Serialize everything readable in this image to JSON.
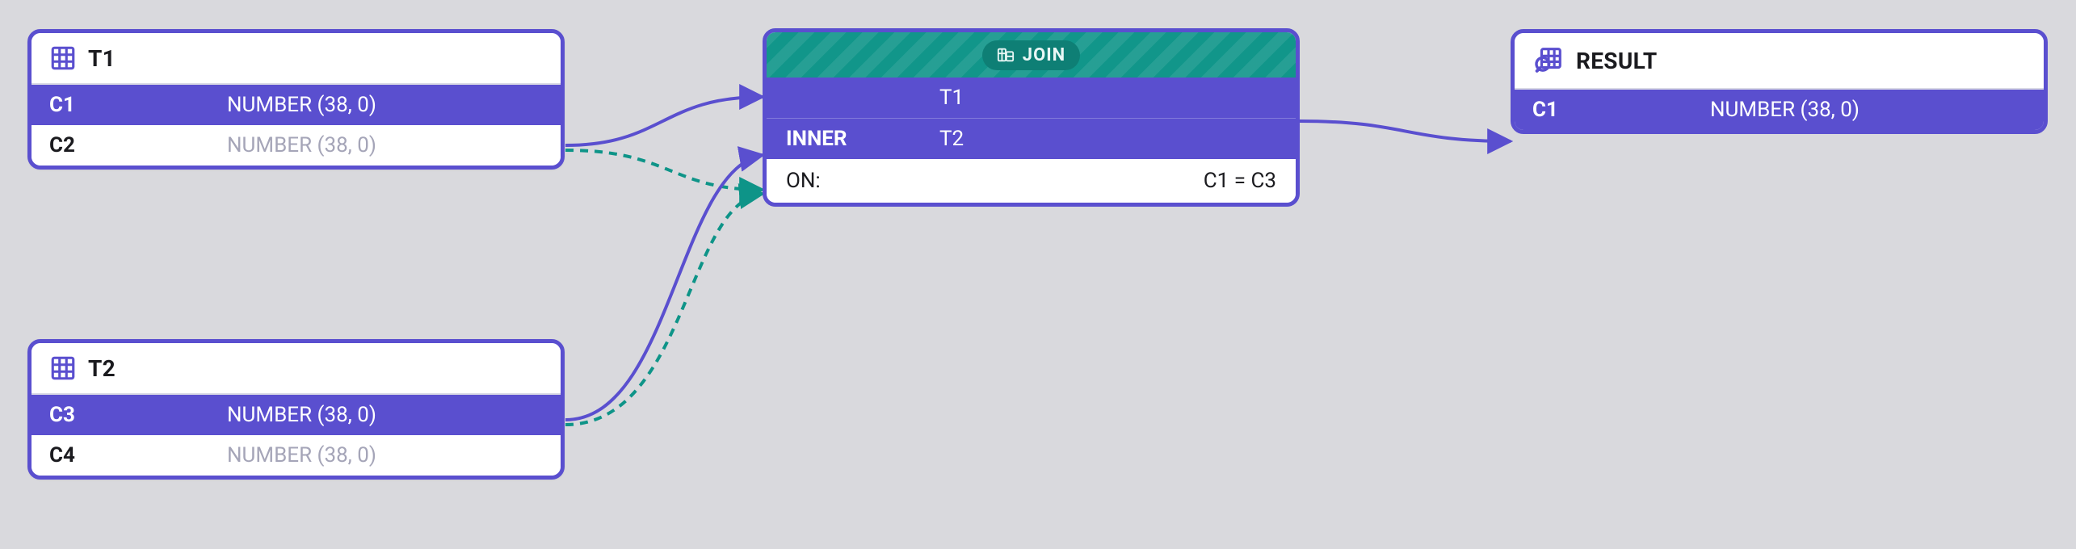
{
  "colors": {
    "accent": "#5a4fcf",
    "teal": "#11968a",
    "tealDark": "#0e7f75",
    "bg": "#d9d9dd"
  },
  "nodes": {
    "t1": {
      "title": "T1",
      "columns": [
        {
          "name": "C1",
          "type": "NUMBER (38, 0)",
          "selected": true
        },
        {
          "name": "C2",
          "type": "NUMBER (38, 0)",
          "selected": false
        }
      ]
    },
    "t2": {
      "title": "T2",
      "columns": [
        {
          "name": "C3",
          "type": "NUMBER (38, 0)",
          "selected": true
        },
        {
          "name": "C4",
          "type": "NUMBER (38, 0)",
          "selected": false
        }
      ]
    },
    "join": {
      "badge": "JOIN",
      "rows": [
        {
          "left": "",
          "center": "T1"
        },
        {
          "left": "INNER",
          "center": "T2"
        }
      ],
      "on_label": "ON:",
      "on_condition": "C1 = C3"
    },
    "result": {
      "title": "RESULT",
      "columns": [
        {
          "name": "C1",
          "type": "NUMBER (38, 0)",
          "selected": true
        }
      ]
    }
  }
}
